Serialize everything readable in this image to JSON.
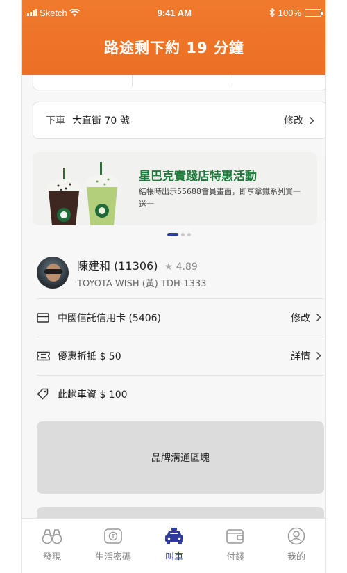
{
  "status_bar": {
    "carrier": "Sketch",
    "time": "9:41 AM",
    "battery": "100%"
  },
  "header": {
    "title": "路途剩下約 19 分鐘"
  },
  "destination": {
    "label": "下車",
    "address": "大直街 70 號",
    "edit_label": "修改"
  },
  "promo": {
    "title": "星巴克實踐店特惠活動",
    "description": "結帳時出示55688會員畫面，即享拿鐵系列買一送一",
    "page_count": 3,
    "active_page": 1
  },
  "driver": {
    "name": "陳建和 (11306)",
    "rating": "4.89",
    "car": "TOYOTA WISH (黃) TDH-1333"
  },
  "payment": {
    "card_label": "中國信託信用卡 (5406)",
    "edit_label": "修改"
  },
  "coupon": {
    "label": "優惠折抵 $ 50",
    "details_label": "詳情"
  },
  "fare": {
    "label": "此趟車資 $ 100"
  },
  "brand_block": {
    "label": "品牌溝通區塊"
  },
  "tabs": [
    {
      "label": "發現",
      "icon": "binoculars-icon",
      "active": false
    },
    {
      "label": "生活密碼",
      "icon": "ticket-icon",
      "active": false
    },
    {
      "label": "叫車",
      "icon": "taxi-icon",
      "active": true
    },
    {
      "label": "付錢",
      "icon": "wallet-icon",
      "active": false
    },
    {
      "label": "我的",
      "icon": "profile-icon",
      "active": false
    }
  ],
  "colors": {
    "header": "#ec6f24",
    "accent": "#2f3c9c",
    "promo_title": "#1e7a3a"
  }
}
